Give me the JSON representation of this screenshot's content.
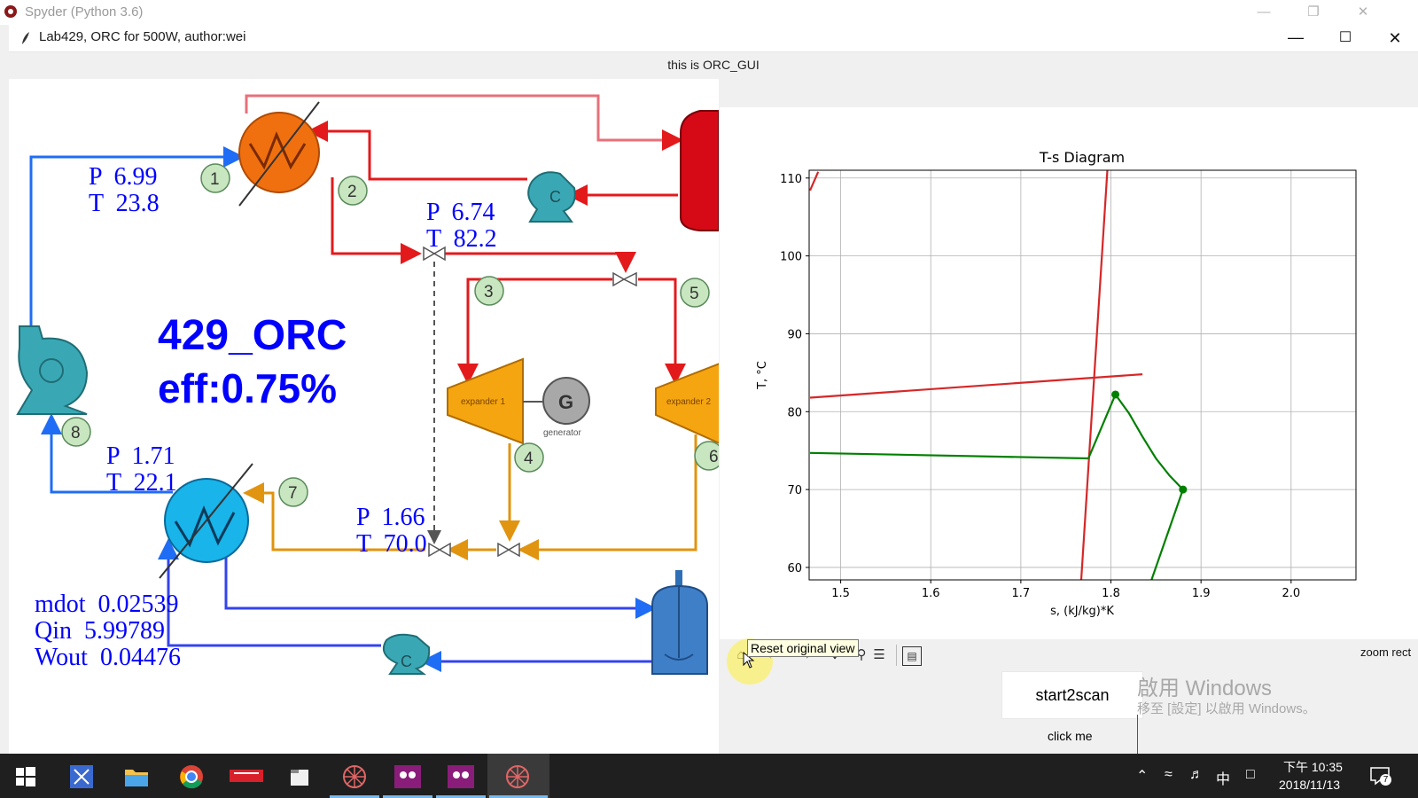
{
  "outer_window": {
    "title": "Spyder (Python 3.6)"
  },
  "window": {
    "title": "Lab429, ORC for 500W, author:wei"
  },
  "header": {
    "text": "this is ORC_GUI"
  },
  "diagram": {
    "big_title": "429_ORC",
    "efficiency": "eff:0.75%",
    "readouts": {
      "p1": "P  6.99",
      "t1": "T  23.8",
      "p2": "P  6.74",
      "t2": "T  82.2",
      "p3": "P  1.71",
      "t3": "T  22.1",
      "p4": "P  1.66",
      "t4": "T  70.0"
    },
    "summary": {
      "mdot": "mdot  0.02539",
      "qin": "Qin  5.99789",
      "wout": "Wout  0.04476"
    },
    "nodes": [
      "1",
      "2",
      "3",
      "4",
      "5",
      "6",
      "7",
      "8"
    ],
    "expander1_label": "expander 1",
    "expander2_label": "expander 2",
    "generator_symbol": "G",
    "generator_label": "generator",
    "pump_symbol": "C",
    "colors": {
      "hot": "#e31a1c",
      "working": "#1f6cf5",
      "exhaust": "#e0940f",
      "heater": "#f07010",
      "cooler": "#1ab0e8",
      "pump": "#3aa8b4",
      "text_blue": "#0000ff"
    }
  },
  "chart": {
    "title": "T-s Diagram",
    "xlabel": "s, (kJ/kg)*K",
    "ylabel": "T, °C",
    "xticks": [
      "1.5",
      "1.6",
      "1.7",
      "1.8",
      "1.9",
      "2.0"
    ],
    "yticks": [
      "60",
      "70",
      "80",
      "90",
      "100",
      "110"
    ]
  },
  "chart_data": {
    "type": "line",
    "title": "T-s Diagram",
    "xlabel": "s, (kJ/kg)*K",
    "ylabel": "T, °C",
    "xlim": [
      1.465,
      2.072
    ],
    "ylim": [
      58.4,
      111
    ],
    "grid": true,
    "series": [
      {
        "color": "#d62728",
        "x": [
          1.466,
          1.475
        ],
        "y": [
          108.4,
          110.8
        ]
      },
      {
        "color": "#d62728",
        "x": [
          1.466,
          1.835
        ],
        "y": [
          81.8,
          84.8
        ]
      },
      {
        "color": "#d62728",
        "x": [
          1.767,
          1.796
        ],
        "y": [
          58.4,
          111
        ]
      },
      {
        "color": "#008000",
        "x": [
          1.466,
          1.775
        ],
        "y": [
          74.7,
          74.0
        ]
      },
      {
        "color": "#008000",
        "x": [
          1.775,
          1.805,
          1.82,
          1.835,
          1.85,
          1.865,
          1.88
        ],
        "y": [
          74.0,
          82.2,
          79.8,
          76.8,
          74.0,
          71.8,
          70.0
        ]
      },
      {
        "color": "#008000",
        "x": [
          1.88,
          1.845
        ],
        "y": [
          70.0,
          58.4
        ]
      }
    ],
    "points": [
      {
        "x": 1.805,
        "y": 82.2,
        "color": "#008000"
      },
      {
        "x": 1.88,
        "y": 70.0,
        "color": "#008000"
      }
    ]
  },
  "toolbar": {
    "home_icon": "home-icon",
    "tooltip": "Reset original view",
    "zoom_text": "zoom rect"
  },
  "buttons": {
    "start": "start2scan",
    "click": "click me"
  },
  "watermark": {
    "line1": "啟用 Windows",
    "line2": "移至 [設定] 以啟用 Windows。"
  },
  "taskbar": {
    "time": "下午 10:35",
    "date": "2018/11/13",
    "ime": "中",
    "notifications": "7",
    "apps": [
      "start-icon",
      "network-app-icon",
      "file-explorer-icon",
      "chrome-icon",
      "unit-app-icon",
      "files-icon",
      "spyder-icon",
      "presentation-app-icon",
      "presentation-app-icon-2",
      "spyder-active-icon"
    ]
  }
}
